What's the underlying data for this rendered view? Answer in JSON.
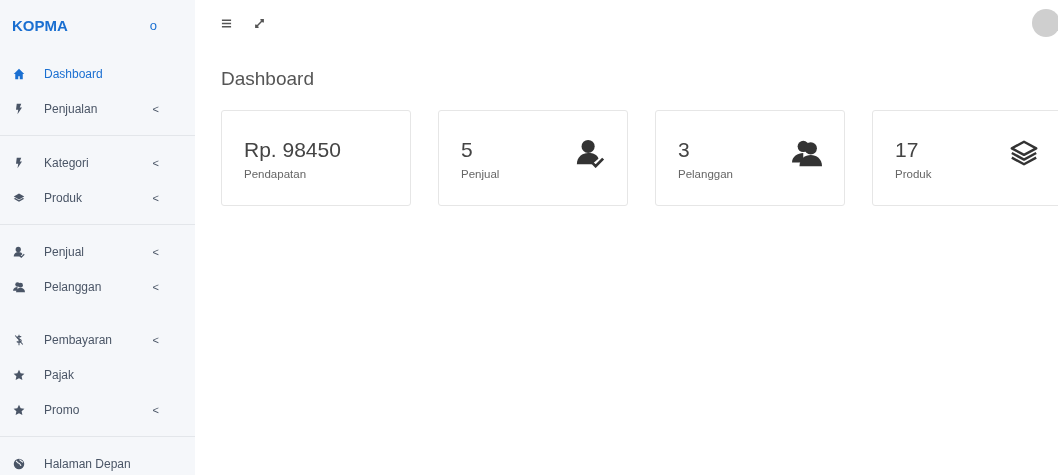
{
  "sidebar": {
    "brand": "KOPMA",
    "toggle": "o",
    "groups": [
      {
        "items": [
          {
            "label": "Dashboard",
            "selected": true
          },
          {
            "label": "Penjualan",
            "selected": false,
            "arrow": "<"
          }
        ]
      },
      {
        "items": [
          {
            "label": "Kategori",
            "selected": false,
            "arrow": "<"
          },
          {
            "label": "Produk",
            "selected": false,
            "arrow": "<"
          }
        ]
      },
      {
        "items": [
          {
            "label": "Penjual",
            "selected": false,
            "arrow": "<"
          },
          {
            "label": "Pelanggan",
            "selected": false,
            "arrow": "<"
          },
          {
            "label": "Pembayaran",
            "selected": false,
            "arrow": "<"
          },
          {
            "label": "Pajak",
            "selected": false
          },
          {
            "label": "Promo",
            "selected": false,
            "arrow": "<"
          }
        ]
      },
      {
        "items": [
          {
            "label": "Halaman Depan",
            "selected": false
          }
        ]
      }
    ]
  },
  "page_title": "Dashboard",
  "cards": [
    {
      "value": "Rp. 98450",
      "label": "Pendapatan"
    },
    {
      "value": "5",
      "label": "Penjual"
    },
    {
      "value": "3",
      "label": "Pelanggan"
    },
    {
      "value": "17",
      "label": "Produk"
    }
  ]
}
